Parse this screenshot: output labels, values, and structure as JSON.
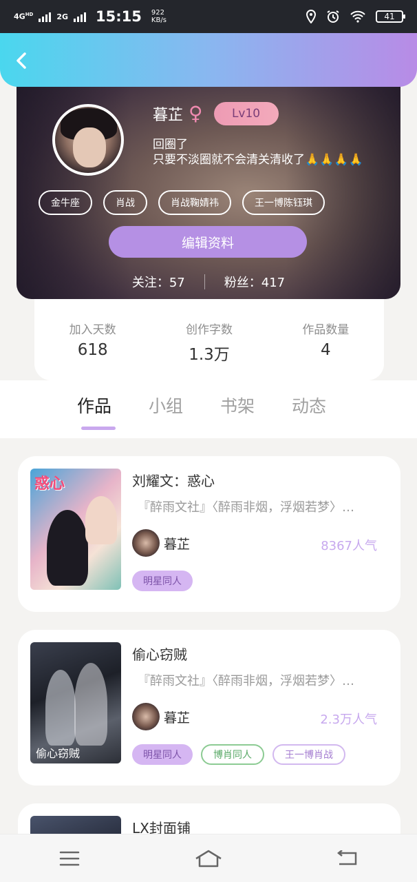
{
  "status_bar": {
    "network_1": "4G",
    "network_1_sup": "HD",
    "network_2": "2G",
    "time": "15:15",
    "speed_value": "922",
    "speed_unit": "KB/s",
    "battery": "41"
  },
  "header": {
    "back_icon": "chevron-left-icon"
  },
  "profile": {
    "name": "暮芷",
    "gender_symbol": "♀",
    "level": "Lv10",
    "bio_line1": "回圈了",
    "bio_line2": "只要不淡圈就不会清关清收了🙏🙏🙏🙏",
    "tags": [
      "金牛座",
      "肖战",
      "肖战鞠婧祎",
      "王一博陈钰琪"
    ],
    "edit_button": "编辑资料",
    "following": "关注：57",
    "followers": "粉丝：417"
  },
  "stats": [
    {
      "label": "加入天数",
      "value": "618"
    },
    {
      "label": "创作字数",
      "value": "1.3万"
    },
    {
      "label": "作品数量",
      "value": "4"
    }
  ],
  "tabs": [
    "作品",
    "小组",
    "书架",
    "动态"
  ],
  "works": [
    {
      "cover_text": "惑心",
      "title": "刘耀文：惑心",
      "description": "『醉雨文社』〈醉雨非烟，浮烟若梦〉…",
      "author": "暮芷",
      "popularity": "8367人气",
      "genres": [
        "明星同人"
      ]
    },
    {
      "cover_text": "偷心窃贼",
      "title": "偷心窃贼",
      "description": "『醉雨文社』〈醉雨非烟，浮烟若梦〉…",
      "author": "暮芷",
      "popularity": "2.3万人气",
      "genres": [
        "明星同人",
        "博肖同人",
        "王一博肖战"
      ]
    },
    {
      "title": "LX封面铺"
    }
  ],
  "navbar": {
    "menu_icon": "menu-icon",
    "home_icon": "home-icon",
    "back_icon": "back-icon"
  }
}
